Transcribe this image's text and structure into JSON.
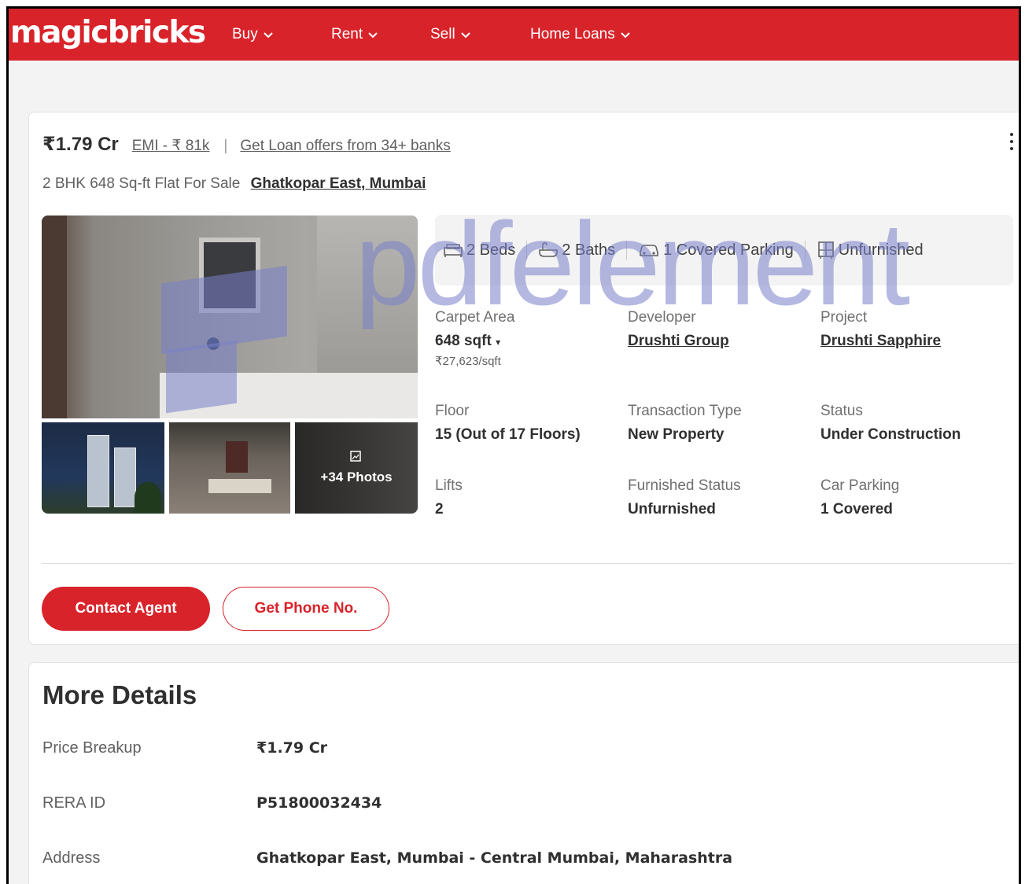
{
  "nav": {
    "logo": "magicbricks",
    "items": [
      {
        "label": "Buy"
      },
      {
        "label": "Rent"
      },
      {
        "label": "Sell"
      },
      {
        "label": "Home Loans"
      }
    ]
  },
  "listing": {
    "price": "₹1.79 Cr",
    "emi": "EMI - ₹ 81k",
    "separator": "|",
    "loan_offer": "Get Loan offers from 34+ banks",
    "title": "2 BHK 648 Sq-ft Flat For Sale",
    "location": "Ghatkopar East, Mumbai",
    "photos_label": "+34 Photos",
    "amenities": [
      {
        "icon": "bed-icon",
        "label": "2 Beds"
      },
      {
        "icon": "bath-icon",
        "label": "2 Baths"
      },
      {
        "icon": "car-icon",
        "label": "1 Covered Parking"
      },
      {
        "icon": "wardrobe-icon",
        "label": "Unfurnished"
      }
    ],
    "specs": {
      "carpet_area": {
        "label": "Carpet Area",
        "value": "648 sqft",
        "sub": "₹27,623/sqft"
      },
      "developer": {
        "label": "Developer",
        "value": "Drushti Group"
      },
      "project": {
        "label": "Project",
        "value": "Drushti Sapphire"
      },
      "floor": {
        "label": "Floor",
        "value": "15 (Out of 17 Floors)"
      },
      "transaction": {
        "label": "Transaction Type",
        "value": "New Property"
      },
      "status": {
        "label": "Status",
        "value": "Under Construction"
      },
      "lifts": {
        "label": "Lifts",
        "value": "2"
      },
      "furnished": {
        "label": "Furnished Status",
        "value": "Unfurnished"
      },
      "car_parking": {
        "label": "Car Parking",
        "value": "1 Covered"
      }
    },
    "buttons": {
      "contact": "Contact Agent",
      "phone": "Get Phone No."
    }
  },
  "more_details": {
    "title": "More Details",
    "rows": [
      {
        "key": "Price Breakup",
        "value": "₹1.79 Cr"
      },
      {
        "key": "RERA ID",
        "value": "P51800032434"
      },
      {
        "key": "Address",
        "value": "Ghatkopar East, Mumbai - Central Mumbai, Maharashtra"
      }
    ]
  },
  "watermark": "pdfelement",
  "colors": {
    "brand_red": "#d8232a",
    "text_dark": "#303030",
    "text_muted": "#606060",
    "watermark": "#7880c8"
  }
}
